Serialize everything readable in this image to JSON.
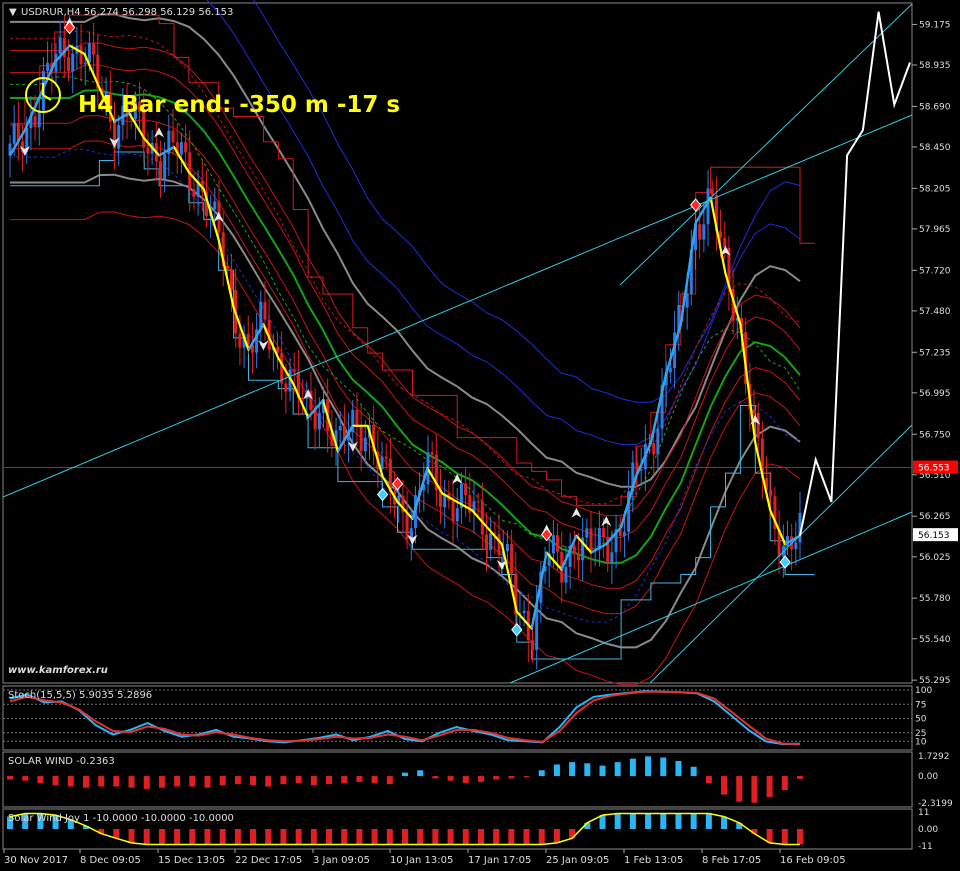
{
  "main": {
    "symbol_line": "USDRUR,H4  56.274 56.298 56.129 56.153",
    "bar_end_label": "H4 Bar end: -350 m -17 s",
    "watermark": "www.kamforex.ru",
    "current_price_label": "56.153",
    "hline_price_label": "56.553"
  },
  "colors": {
    "background": "#000000",
    "bull": "#2c7be5",
    "bear": "#e02020",
    "yellow_line": "#ffff00",
    "channel_green": "#13a313",
    "channel_gray": "#8a8a8a",
    "channel_red": "#c81414",
    "channel_blue": "#1a2fd6",
    "trend_cyan": "#2ecbe0",
    "projection": "#ffffff",
    "hline": "#ff0000"
  },
  "chart_data": [
    {
      "type": "candlestick",
      "symbol": "USDRUR",
      "timeframe": "H4",
      "ohlc_last": {
        "open": 56.274,
        "high": 56.298,
        "low": 56.129,
        "close": 56.153
      },
      "ylim": [
        55.29,
        59.29
      ],
      "y_ticks": [
        59.175,
        58.935,
        58.69,
        58.45,
        58.205,
        57.965,
        57.72,
        57.48,
        57.235,
        56.995,
        56.75,
        56.51,
        56.265,
        56.025,
        55.78,
        55.54,
        55.295
      ],
      "x_ticks": [
        "30 Nov 2017",
        "8 Dec 09:05",
        "15 Dec 13:05",
        "22 Dec 17:05",
        "3 Jan 09:05",
        "10 Jan 13:05",
        "17 Jan 17:05",
        "25 Jan 09:05",
        "1 Feb 13:05",
        "8 Feb 17:05",
        "16 Feb 09:05"
      ],
      "hline": 56.553,
      "close_path": [
        58.4,
        58.55,
        58.75,
        58.95,
        59.05,
        59.0,
        58.8,
        58.6,
        58.65,
        58.5,
        58.4,
        58.45,
        58.3,
        58.2,
        57.9,
        57.5,
        57.25,
        57.4,
        57.2,
        57.05,
        56.85,
        56.95,
        56.65,
        56.8,
        56.8,
        56.5,
        56.35,
        56.25,
        56.55,
        56.4,
        56.35,
        56.3,
        56.2,
        56.1,
        55.7,
        55.6,
        56.05,
        55.95,
        56.15,
        56.05,
        56.1,
        56.2,
        56.5,
        56.7,
        57.1,
        57.4,
        58.0,
        58.15,
        57.7,
        57.4,
        56.7,
        56.3,
        56.1,
        56.15
      ],
      "projection": [
        56.15,
        56.6,
        56.35,
        58.4,
        58.55,
        59.25,
        58.7,
        58.95
      ],
      "series": [
        {
          "name": "USDRUR,H4"
        }
      ]
    },
    {
      "type": "line",
      "title": "Stoch(15,5,5) 5.9035 5.2896",
      "ylim": [
        0,
        100
      ],
      "y_ticks": [
        100,
        75,
        50,
        25,
        10,
        0
      ],
      "y_tick_labels": [
        "100",
        "75",
        "50",
        "25",
        "10"
      ],
      "series": [
        {
          "name": "main",
          "values": [
            85,
            92,
            78,
            80,
            65,
            38,
            22,
            30,
            42,
            28,
            18,
            22,
            30,
            18,
            15,
            10,
            8,
            12,
            16,
            22,
            12,
            18,
            28,
            14,
            10,
            25,
            35,
            28,
            22,
            12,
            10,
            8,
            35,
            70,
            88,
            92,
            95,
            98,
            97,
            96,
            94,
            80,
            55,
            30,
            10,
            5,
            6
          ]
        },
        {
          "name": "signal",
          "values": [
            80,
            88,
            82,
            78,
            66,
            45,
            28,
            26,
            36,
            32,
            22,
            20,
            26,
            22,
            16,
            12,
            10,
            11,
            14,
            18,
            15,
            16,
            22,
            18,
            12,
            20,
            30,
            30,
            25,
            16,
            12,
            9,
            28,
            60,
            82,
            90,
            94,
            97,
            97,
            96,
            95,
            85,
            62,
            38,
            15,
            6,
            5
          ]
        }
      ]
    },
    {
      "type": "bar",
      "title": "SOLAR WIND -0.2363",
      "ylim": [
        -2.3199,
        1.7292
      ],
      "y_ticks": [
        1.7292,
        0.0,
        -2.3199
      ],
      "y_tick_labels": [
        "1.7292",
        "0.00",
        "-2.3199"
      ],
      "values": [
        -0.3,
        -0.4,
        -0.6,
        -0.8,
        -0.9,
        -1.0,
        -0.9,
        -0.9,
        -1.0,
        -1.1,
        -1.0,
        -0.9,
        -0.9,
        -1.0,
        -0.8,
        -0.7,
        -0.8,
        -0.9,
        -0.7,
        -0.6,
        -0.8,
        -0.7,
        -0.6,
        -0.5,
        -0.6,
        -0.7,
        0.3,
        0.5,
        -0.2,
        -0.4,
        -0.6,
        -0.5,
        -0.3,
        -0.2,
        -0.1,
        0.5,
        1.0,
        1.2,
        1.1,
        0.9,
        1.2,
        1.5,
        1.7,
        1.6,
        1.3,
        0.8,
        -0.6,
        -1.6,
        -2.2,
        -2.3,
        -1.8,
        -1.2,
        -0.24
      ]
    },
    {
      "type": "bar",
      "title": "Solar Wind Joy 1 -10.0000 -10.0000 -10.0000",
      "ylim": [
        -11,
        11
      ],
      "y_ticks": [
        11,
        0.0,
        -11
      ],
      "y_tick_labels": [
        "11",
        "0.00",
        "-11"
      ],
      "values": [
        8,
        10,
        10,
        9,
        6,
        2,
        -3,
        -6,
        -9,
        -10,
        -10,
        -10,
        -10,
        -10,
        -10,
        -10,
        -10,
        -10,
        -10,
        -10,
        -10,
        -10,
        -10,
        -10,
        -10,
        -10,
        -10,
        -10,
        -10,
        -10,
        -10,
        -10,
        -10,
        -10,
        -10,
        -10,
        -9,
        -6,
        4,
        9,
        10,
        10,
        10,
        10,
        10,
        10,
        10,
        8,
        4,
        -3,
        -9,
        -10,
        -10
      ]
    }
  ]
}
